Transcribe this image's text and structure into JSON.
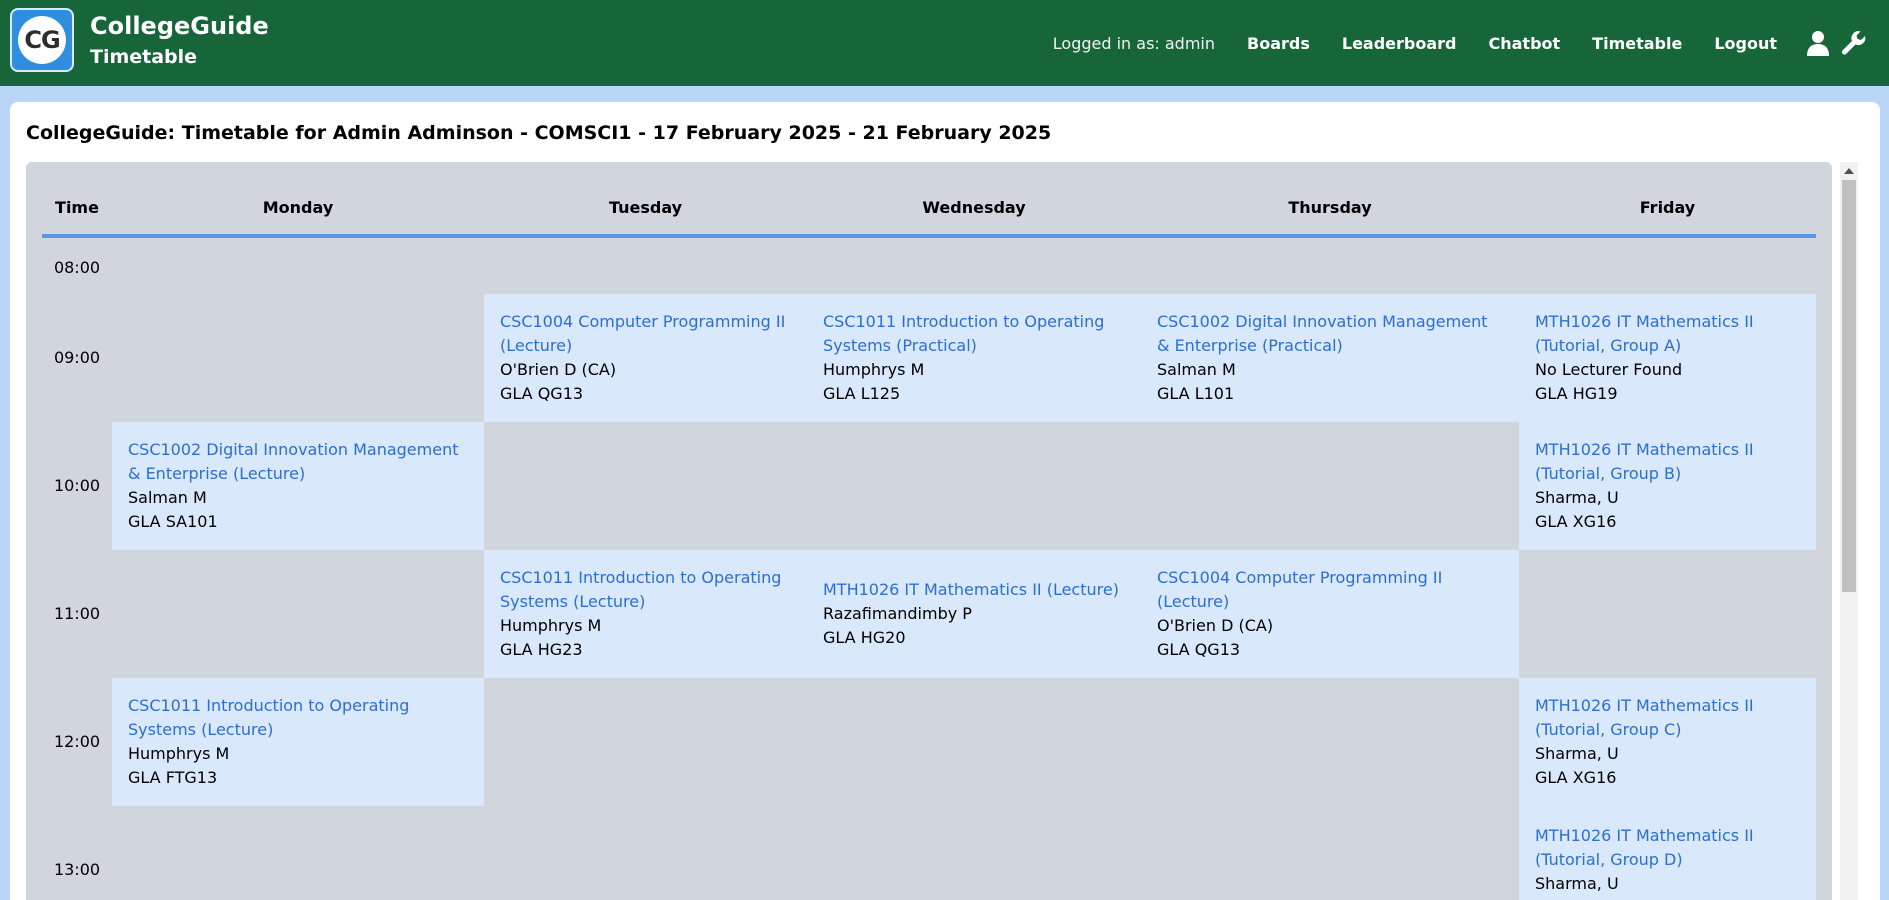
{
  "header": {
    "logo_text": "CG",
    "brand_title": "CollegeGuide",
    "brand_subtitle": "Timetable",
    "logged_in": "Logged in as: admin",
    "nav": [
      "Boards",
      "Leaderboard",
      "Chatbot",
      "Timetable",
      "Logout"
    ],
    "icons": [
      "user-icon",
      "wrench-icon"
    ]
  },
  "page": {
    "title": "CollegeGuide: Timetable for Admin Adminson - COMSCI1 - 17 February 2025 - 21 February 2025"
  },
  "timetable": {
    "columns": [
      "Time",
      "Monday",
      "Tuesday",
      "Wednesday",
      "Thursday",
      "Friday"
    ],
    "times": [
      "08:00",
      "09:00",
      "10:00",
      "11:00",
      "12:00",
      "13:00"
    ],
    "slots": [
      {
        "day": "Tuesday",
        "time": "09:00",
        "course": "CSC1004 Computer Programming II (Lecture)",
        "lecturer": "O'Brien D (CA)",
        "room": "GLA QG13"
      },
      {
        "day": "Wednesday",
        "time": "09:00",
        "course": "CSC1011 Introduction to Operating Systems (Practical)",
        "lecturer": "Humphrys M",
        "room": "GLA L125"
      },
      {
        "day": "Thursday",
        "time": "09:00",
        "course": "CSC1002 Digital Innovation Management & Enterprise (Practical)",
        "lecturer": "Salman M",
        "room": "GLA L101"
      },
      {
        "day": "Friday",
        "time": "09:00",
        "course": "MTH1026 IT Mathematics II (Tutorial, Group A)",
        "lecturer": "No Lecturer Found",
        "room": "GLA HG19"
      },
      {
        "day": "Monday",
        "time": "10:00",
        "course": "CSC1002 Digital Innovation Management & Enterprise (Lecture)",
        "lecturer": "Salman M",
        "room": "GLA SA101"
      },
      {
        "day": "Friday",
        "time": "10:00",
        "course": "MTH1026 IT Mathematics II (Tutorial, Group B)",
        "lecturer": "Sharma, U",
        "room": "GLA XG16"
      },
      {
        "day": "Tuesday",
        "time": "11:00",
        "course": "CSC1011 Introduction to Operating Systems (Lecture)",
        "lecturer": "Humphrys M",
        "room": "GLA HG23"
      },
      {
        "day": "Wednesday",
        "time": "11:00",
        "course": "MTH1026 IT Mathematics II (Lecture)",
        "lecturer": "Razafimandimby P",
        "room": "GLA HG20"
      },
      {
        "day": "Thursday",
        "time": "11:00",
        "course": "CSC1004 Computer Programming II (Lecture)",
        "lecturer": "O'Brien D (CA)",
        "room": "GLA QG13"
      },
      {
        "day": "Monday",
        "time": "12:00",
        "course": "CSC1011 Introduction to Operating Systems (Lecture)",
        "lecturer": "Humphrys M",
        "room": "GLA FTG13"
      },
      {
        "day": "Friday",
        "time": "12:00",
        "course": "MTH1026 IT Mathematics II (Tutorial, Group C)",
        "lecturer": "Sharma, U",
        "room": "GLA XG16"
      },
      {
        "day": "Friday",
        "time": "13:00",
        "course": "MTH1026 IT Mathematics II (Tutorial, Group D)",
        "lecturer": "Sharma, U",
        "room": ""
      }
    ]
  },
  "colors": {
    "header_bg": "#17663a",
    "page_bg": "#b9d6f7",
    "grid_bg": "#d1d5dc",
    "slot_bg": "#d9e8fb",
    "link": "#2b6fd4",
    "header_rule": "#5797e6"
  }
}
